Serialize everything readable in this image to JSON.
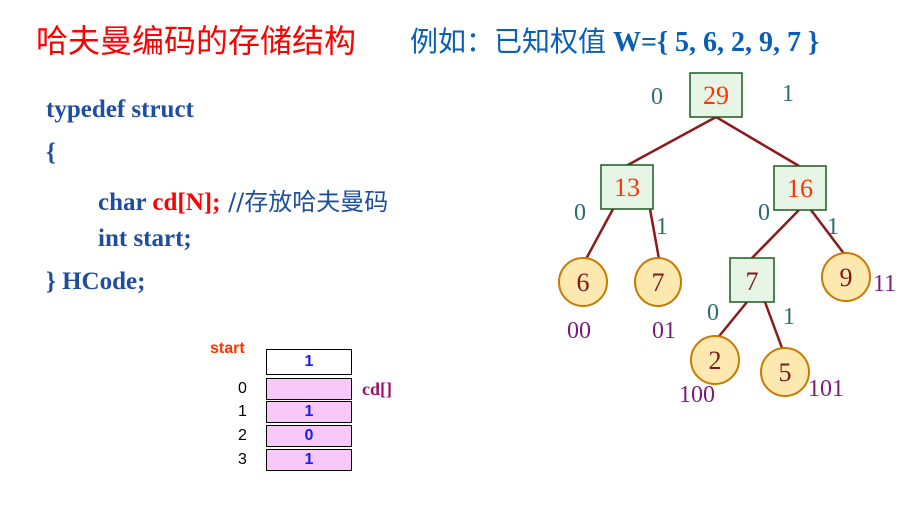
{
  "title": "哈夫曼编码的存储结构",
  "subtitle": {
    "prefix": "例如：已知权值",
    "formula": "W={ 5, 6, 2, 9, 7 }"
  },
  "code": {
    "line1": "typedef  struct",
    "line2": "{",
    "line3_kw": "char ",
    "line3_var": "cd[N];",
    "line3_comment": "  //存放哈夫曼码",
    "line4_kw": "int ",
    "line4_var": "start;",
    "line5": "} HCode;"
  },
  "array": {
    "start_label": "start",
    "start_value": "1",
    "cd_label": "cd[]",
    "indices": [
      "0",
      "1",
      "2",
      "3"
    ],
    "cells": [
      "",
      "1",
      "0",
      "1"
    ]
  },
  "tree": {
    "nodes": [
      {
        "id": "n29",
        "label": "29",
        "shape": "rect"
      },
      {
        "id": "n13",
        "label": "13",
        "shape": "rect"
      },
      {
        "id": "n16",
        "label": "16",
        "shape": "rect"
      },
      {
        "id": "n6",
        "label": "6",
        "shape": "circle"
      },
      {
        "id": "n7a",
        "label": "7",
        "shape": "circle"
      },
      {
        "id": "n7b",
        "label": "7",
        "shape": "rect"
      },
      {
        "id": "n9",
        "label": "9",
        "shape": "circle"
      },
      {
        "id": "n2",
        "label": "2",
        "shape": "circle"
      },
      {
        "id": "n5",
        "label": "5",
        "shape": "circle"
      }
    ],
    "edge_labels": {
      "root_left": "0",
      "root_right": "1",
      "n13_left": "0",
      "n13_right": "1",
      "n16_left": "0",
      "n16_right": "1",
      "n7b_left": "0",
      "n7b_right": "1"
    },
    "codes": {
      "n6": "00",
      "n7a": "01",
      "n9": "11",
      "n2": "100",
      "n5": "101"
    }
  },
  "colors": {
    "title": "#ff0000",
    "code": "#1f4e9c",
    "node_fill_rect": "#e6f5e6",
    "node_fill_circle": "#fde9b0",
    "node_label": "#ff3300",
    "edge": "#8b1a1a",
    "code_label": "#7a1a7a",
    "edge_label": "#2e6b6b",
    "cell_fill": "#f8c8f8"
  }
}
